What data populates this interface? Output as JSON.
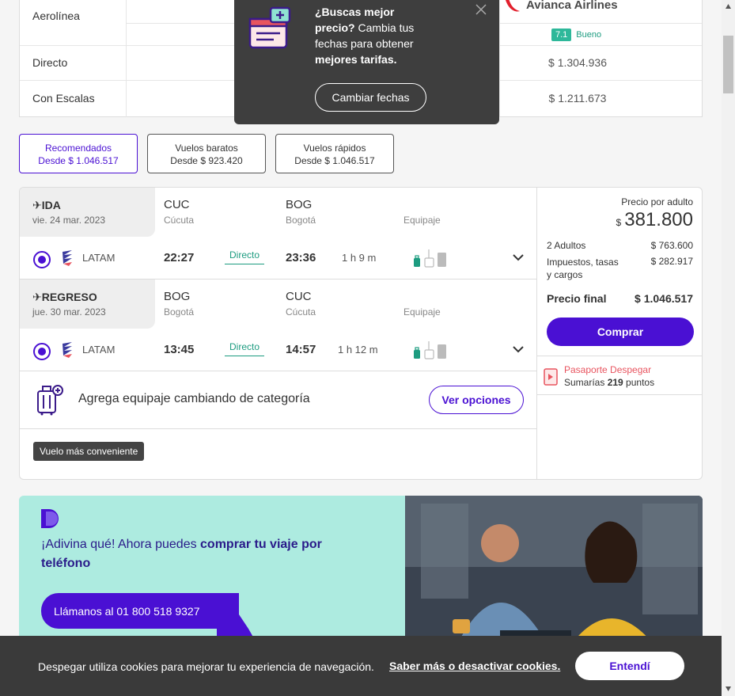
{
  "compare_table": {
    "row_airline_label": "Aerolínea",
    "row_direct_label": "Directo",
    "row_stops_label": "Con Escalas",
    "airline_name": "Avianca Airlines",
    "rating_score": "7.1",
    "rating_word": "Bueno",
    "direct_price": "$ 1.304.936",
    "stops_price": "$ 1.211.673"
  },
  "tooltip": {
    "title_bold": "¿Buscas mejor precio?",
    "text": " Cambia tus fechas para obtener ",
    "text_bold": "mejores tarifas.",
    "button": "Cambiar fechas",
    "close_icon": "close-icon"
  },
  "tabs": [
    {
      "label": "Recomendados",
      "sub": "Desde $ 1.046.517"
    },
    {
      "label": "Vuelos baratos",
      "sub": "Desde $ 923.420"
    },
    {
      "label": "Vuelos rápidos",
      "sub": "Desde $ 1.046.517"
    }
  ],
  "outbound": {
    "head": "✈IDA",
    "date": "vie. 24 mar. 2023",
    "from_code": "CUC",
    "from_city": "Cúcuta",
    "to_code": "BOG",
    "to_city": "Bogotá",
    "equip_label": "Equipaje",
    "airline": "LATAM",
    "dep": "22:27",
    "stops": "Directo",
    "arr": "23:36",
    "duration": "1 h 9 m"
  },
  "inbound": {
    "head": "✈REGRESO",
    "date": "jue. 30 mar. 2023",
    "from_code": "BOG",
    "from_city": "Bogotá",
    "to_code": "CUC",
    "to_city": "Cúcuta",
    "equip_label": "Equipaje",
    "airline": "LATAM",
    "dep": "13:45",
    "stops": "Directo",
    "arr": "14:57",
    "duration": "1 h 12 m"
  },
  "luggage": {
    "text": "Agrega equipaje cambiando de categoría",
    "button": "Ver opciones"
  },
  "badge": "Vuelo más conveniente",
  "pricing": {
    "per_adult_label": "Precio por adulto",
    "currency": "$",
    "per_adult": "381.800",
    "adults_label": "2 Adultos",
    "adults_value": "$ 763.600",
    "taxes_label": "Impuestos, tasas y cargos",
    "taxes_value": "$ 282.917",
    "final_label": "Precio final",
    "final_value": "$ 1.046.517",
    "buy": "Comprar",
    "passport_title": "Pasaporte Despegar",
    "passport_pre": "Sumarías ",
    "passport_points": "219",
    "passport_post": " puntos"
  },
  "promo": {
    "text_pre": "¡Adivina qué! Ahora puedes ",
    "text_bold": "comprar tu viaje por teléfono",
    "call": "Llámanos al 01 800 518 9327"
  },
  "cookie": {
    "message": "Despegar utiliza cookies para mejorar tu experiencia de navegación.",
    "link": "Saber más o desactivar cookies.",
    "accept": "Entendí"
  },
  "colors": {
    "brand": "#4a10d3",
    "green": "#1d9c80",
    "promo_bg": "#adebe0",
    "dark": "#3a3a3a"
  }
}
